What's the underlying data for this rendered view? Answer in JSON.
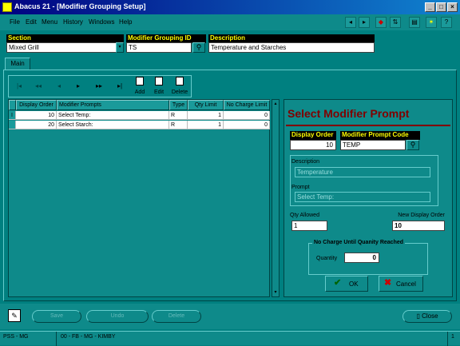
{
  "window": {
    "title": "Abacus 21 - [Modifier Grouping Setup]"
  },
  "menu": [
    "File",
    "Edit",
    "Menu",
    "History",
    "Windows",
    "Help"
  ],
  "header": {
    "section": {
      "label": "Section",
      "value": "Mixed Grill"
    },
    "group_id": {
      "label": "Modifier Grouping ID",
      "value": "TS"
    },
    "description": {
      "label": "Description",
      "value": "Temperature and Starches"
    }
  },
  "tab": "Main",
  "nav": {
    "add": "Add",
    "edit": "Edit",
    "delete": "Delete"
  },
  "grid": {
    "columns": [
      "Display Order",
      "Modifier Prompts",
      "Type",
      "Qty Limit",
      "No Charge Limit"
    ],
    "rows": [
      {
        "marker": "I",
        "order": "10",
        "prompt": "Select Temp:",
        "type": "R",
        "qty": "1",
        "nocharge": "0"
      },
      {
        "marker": "",
        "order": "20",
        "prompt": "Select Starch:",
        "type": "R",
        "qty": "1",
        "nocharge": "0"
      }
    ]
  },
  "panel": {
    "title": "Select Modifier Prompt",
    "display_order": {
      "label": "Display Order",
      "value": "10"
    },
    "prompt_code": {
      "label": "Modifier Prompt Code",
      "value": "TEMP"
    },
    "description": {
      "label": "Description",
      "value": "Temperature"
    },
    "prompt": {
      "label": "Prompt",
      "value": "Select Temp:"
    },
    "qty_allowed": {
      "label": "Qty Allowed",
      "value": "1"
    },
    "new_display_order": {
      "label": "New Display Order",
      "value": "10"
    },
    "no_charge_group": "No Charge Until Quanity Reached",
    "quantity": {
      "label": "Quantity",
      "value": "0"
    },
    "ok": "OK",
    "cancel": "Cancel"
  },
  "bottom": {
    "save": "Save",
    "undo": "Undo",
    "delete": "Delete",
    "close": "Close"
  },
  "status": {
    "left": "PSS - MG",
    "middle": "00 - FB - MG - KIMBY",
    "page": "1"
  }
}
